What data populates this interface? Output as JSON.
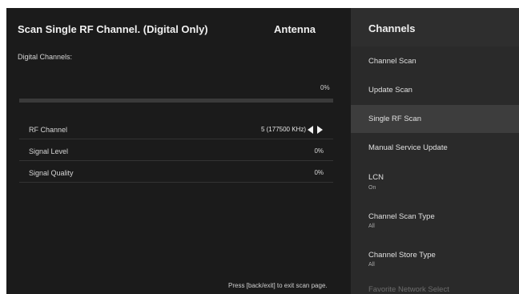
{
  "scan": {
    "title": "Scan Single RF Channel. (Digital Only)",
    "source": "Antenna",
    "digital_channels_label": "Digital Channels:",
    "progress_text": "0%",
    "progress_fraction": 0,
    "rows": [
      {
        "label": "RF Channel",
        "value": "5 (177500 KHz)"
      },
      {
        "label": "Signal Level",
        "value": "0%"
      },
      {
        "label": "Signal Quality",
        "value": "0%"
      }
    ],
    "exit_hint": "Press [back/exit] to exit scan page."
  },
  "menu": {
    "title": "Channels",
    "items": [
      {
        "label": "Channel Scan"
      },
      {
        "label": "Update Scan"
      },
      {
        "label": "Single RF Scan"
      },
      {
        "label": "Manual Service Update"
      },
      {
        "label": "LCN",
        "sub": "On"
      },
      {
        "label": "Channel Scan Type",
        "sub": "All"
      },
      {
        "label": "Channel Store Type",
        "sub": "All"
      },
      {
        "label": "Favorite Network Select"
      }
    ],
    "selected_index": 2
  },
  "colors": {
    "scan_bg": "#1b1b1b",
    "menu_bg": "#2a2a2a",
    "selected_bg": "#3d3d3d",
    "text": "#e6e6e6"
  }
}
